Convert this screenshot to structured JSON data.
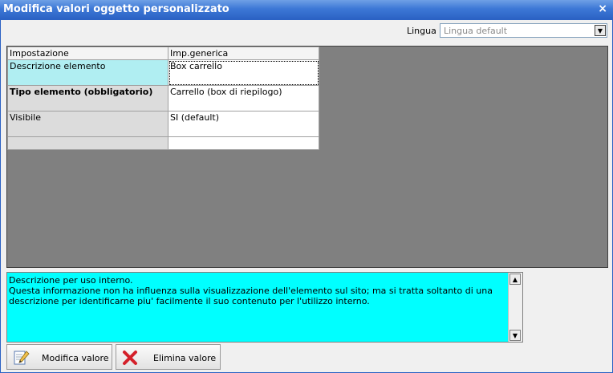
{
  "window": {
    "title": "Modifica valori oggetto personalizzato",
    "close_glyph": "×"
  },
  "language": {
    "label": "Lingua :",
    "value": "Lingua default"
  },
  "grid": {
    "headers": [
      "Impostazione",
      "Imp.generica"
    ],
    "rows": [
      {
        "key": "Descrizione elemento",
        "value": "Box carrello"
      },
      {
        "key": "Tipo elemento (obbligatorio)",
        "value": "Carrello (box di riepilogo)"
      },
      {
        "key": "Visibile",
        "value": "SI (default)"
      },
      {
        "key": "",
        "value": ""
      }
    ]
  },
  "description": {
    "text": "Descrizione per uso interno.\nQuesta informazione non ha influenza sulla visualizzazione dell'elemento sul sito; ma si tratta soltanto di una descrizione per identificarne piu' facilmente il suo contenuto per l'utilizzo interno."
  },
  "actions": {
    "edit_label": "Modifica valore",
    "delete_label": "Elimina valore"
  },
  "colors": {
    "titlebar": "#2b62c4",
    "selected_row": "#b0eef2",
    "description_bg": "#00ffff",
    "grid_area": "#808080"
  },
  "icons": {
    "close": "close-icon",
    "edit": "pencil-document-icon",
    "delete": "red-x-icon"
  }
}
